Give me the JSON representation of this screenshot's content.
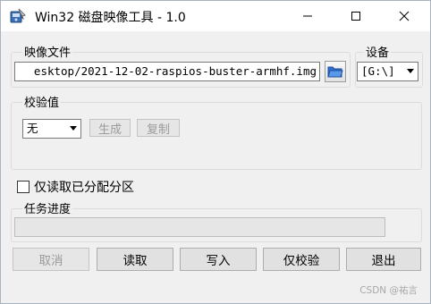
{
  "window": {
    "title": "Win32 磁盘映像工具 - 1.0"
  },
  "image_file": {
    "group_label": "映像文件",
    "path_value": "esktop/2021-12-02-raspios-buster-armhf.img"
  },
  "device": {
    "group_label": "设备",
    "selected": "[G:\\]"
  },
  "checksum": {
    "group_label": "校验值",
    "type_selected": "无",
    "generate_label": "生成",
    "copy_label": "复制"
  },
  "read_only_alloc": {
    "label": "仅读取已分配分区",
    "checked": false
  },
  "progress": {
    "group_label": "任务进度",
    "value": 0
  },
  "buttons": {
    "cancel": "取消",
    "read": "读取",
    "write": "写入",
    "verify_only": "仅校验",
    "exit": "退出"
  },
  "watermark": "CSDN @祐言",
  "icons": {
    "app": "disk-writer-icon",
    "folder": "folder-open-icon"
  },
  "colors": {
    "window_bg": "#f0f0f0",
    "folder_blue": "#2f6fd1",
    "disabled_text": "#9b9b9b"
  }
}
